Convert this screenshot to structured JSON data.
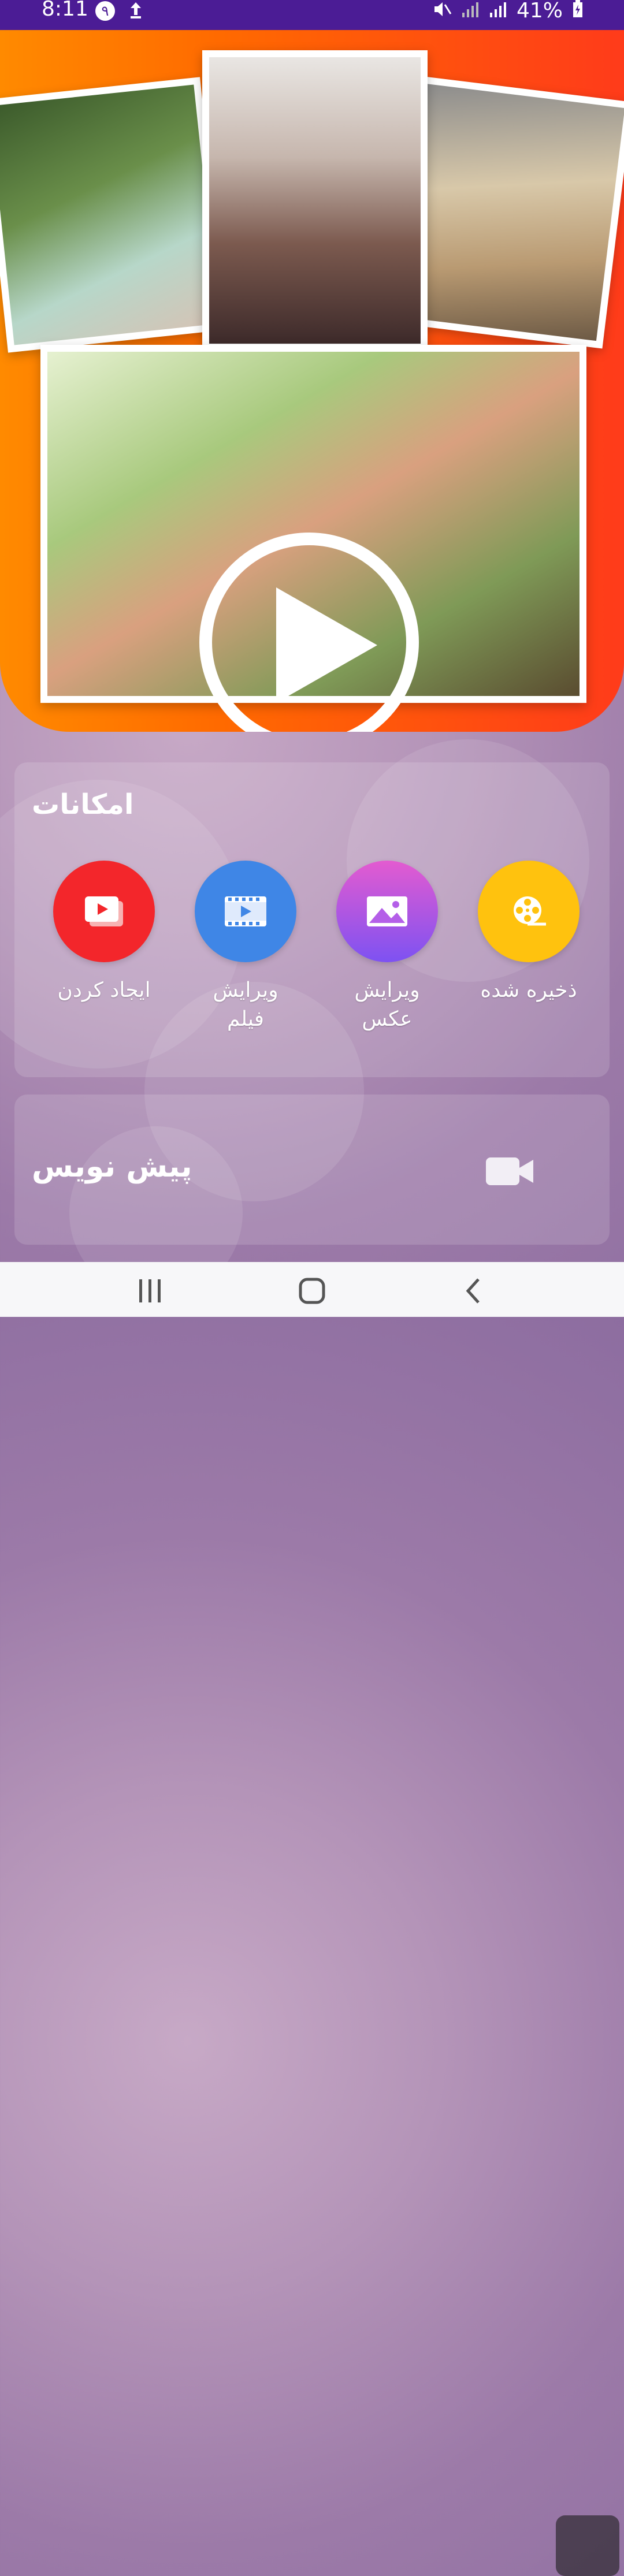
{
  "status_bar": {
    "time": "8:11",
    "left_icons": [
      "notification-badge-icon",
      "cloud-upload-icon"
    ],
    "badge_text": "٩",
    "battery": "41%",
    "right_icons": [
      "mute-icon",
      "signal-icon",
      "signal-icon",
      "battery-charging-icon"
    ]
  },
  "hero": {
    "icons": [
      "play-icon"
    ]
  },
  "features": {
    "title": "امکانات",
    "items": [
      {
        "label": "ایجاد کردن",
        "icon": "youtube-create-icon",
        "color": "#f3262b"
      },
      {
        "label": "ویرایش\nفیلم",
        "icon": "film-edit-icon",
        "color": "#3f86e6"
      },
      {
        "label": "ویرایش\nعکس",
        "icon": "image-edit-icon",
        "color": "#a856e6"
      },
      {
        "label": "ذخیره شده",
        "icon": "film-reel-icon",
        "color": "#ffc20e"
      }
    ]
  },
  "draft": {
    "title": "پیش نویس",
    "icon": "video-camera-icon"
  },
  "navbar": {
    "buttons": [
      "recents-icon",
      "home-icon",
      "back-icon"
    ]
  },
  "colors": {
    "statusbar": "#4b1c95",
    "hero_orange": "#ff6a00",
    "hero_red": "#ff3b1a"
  }
}
